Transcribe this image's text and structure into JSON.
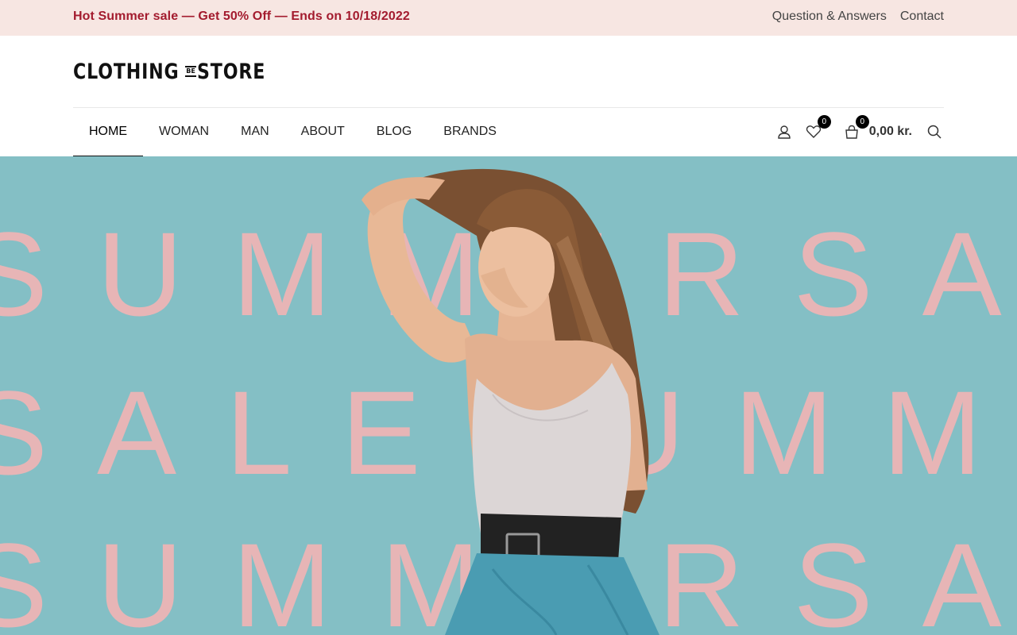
{
  "topbar": {
    "promo": "Hot Summer sale — Get 50% Off — Ends on 10/18/2022",
    "links": [
      "Question & Answers",
      "Contact"
    ]
  },
  "logo": {
    "left": "CLOTHING",
    "middle": "BE",
    "right": "STORE"
  },
  "nav": {
    "items": [
      "HOME",
      "WOMAN",
      "MAN",
      "ABOUT",
      "BLOG",
      "BRANDS"
    ],
    "active": "HOME"
  },
  "tools": {
    "wishlist_count": "0",
    "cart_count": "0",
    "cart_total": "0,00 kr."
  },
  "icons": [
    "user-icon",
    "heart-icon",
    "bag-icon",
    "search-icon"
  ],
  "hero": {
    "lines": [
      "SUMMERSAL",
      "SALESUMMER",
      "SUMMERSAL"
    ]
  },
  "colors": {
    "topbar_bg": "#f7e6e2",
    "promo_text": "#a31b2e",
    "hero_bg": "#84bfc5",
    "hero_text": "#e7b5b6"
  }
}
